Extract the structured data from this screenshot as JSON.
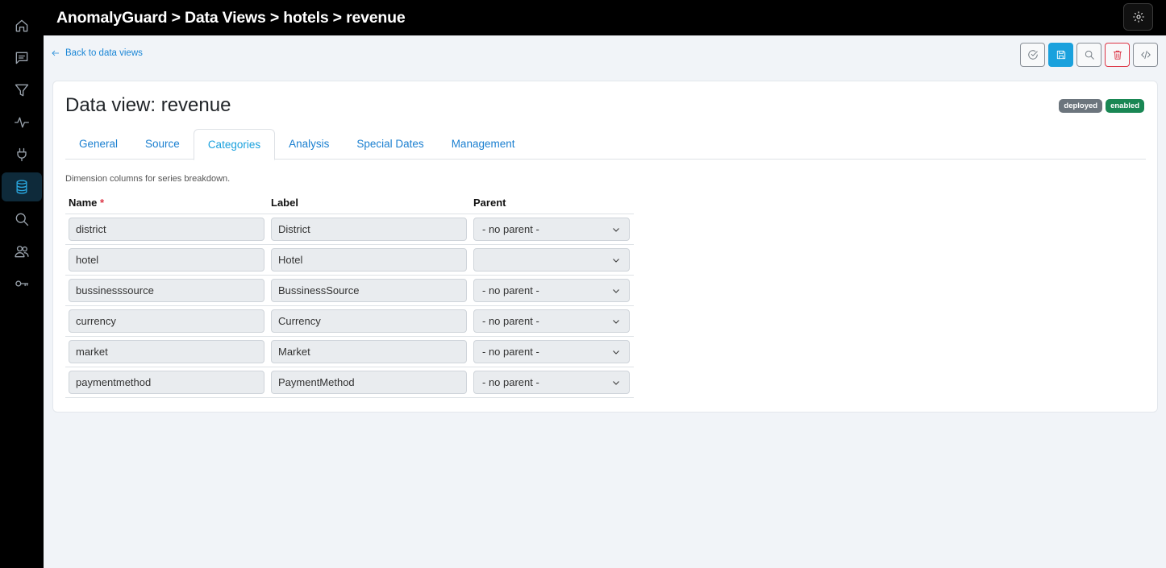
{
  "header": {
    "title": "AnomalyGuard > Data Views > hotels > revenue"
  },
  "sidebar": {
    "items": [
      {
        "icon": "home-icon"
      },
      {
        "icon": "chat-icon"
      },
      {
        "icon": "filter-icon"
      },
      {
        "icon": "activity-icon"
      },
      {
        "icon": "plug-icon"
      },
      {
        "icon": "database-icon",
        "active": true
      },
      {
        "icon": "search-icon"
      },
      {
        "icon": "users-icon"
      },
      {
        "icon": "key-icon"
      }
    ]
  },
  "toolbar": {
    "back_label": "Back to data views"
  },
  "card": {
    "title": "Data view: revenue",
    "badges": [
      "deployed",
      "enabled"
    ],
    "tabs": [
      "General",
      "Source",
      "Categories",
      "Analysis",
      "Special Dates",
      "Management"
    ],
    "active_tab": "Categories",
    "description": "Dimension columns for series breakdown."
  },
  "table": {
    "headers": {
      "name": "Name",
      "required_mark": "*",
      "label": "Label",
      "parent": "Parent"
    },
    "rows": [
      {
        "name": "district",
        "label": "District",
        "parent": "- no parent -"
      },
      {
        "name": "hotel",
        "label": "Hotel",
        "parent": ""
      },
      {
        "name": "bussinesssource",
        "label": "BussinessSource",
        "parent": "- no parent -"
      },
      {
        "name": "currency",
        "label": "Currency",
        "parent": "- no parent -"
      },
      {
        "name": "market",
        "label": "Market",
        "parent": "- no parent -"
      },
      {
        "name": "paymentmethod",
        "label": "PaymentMethod",
        "parent": "- no parent -"
      }
    ]
  },
  "colors": {
    "accent": "#1aa1dd",
    "link": "#1a86d6",
    "danger": "#dc3545",
    "deployed": "#6c757d",
    "enabled": "#198754"
  }
}
